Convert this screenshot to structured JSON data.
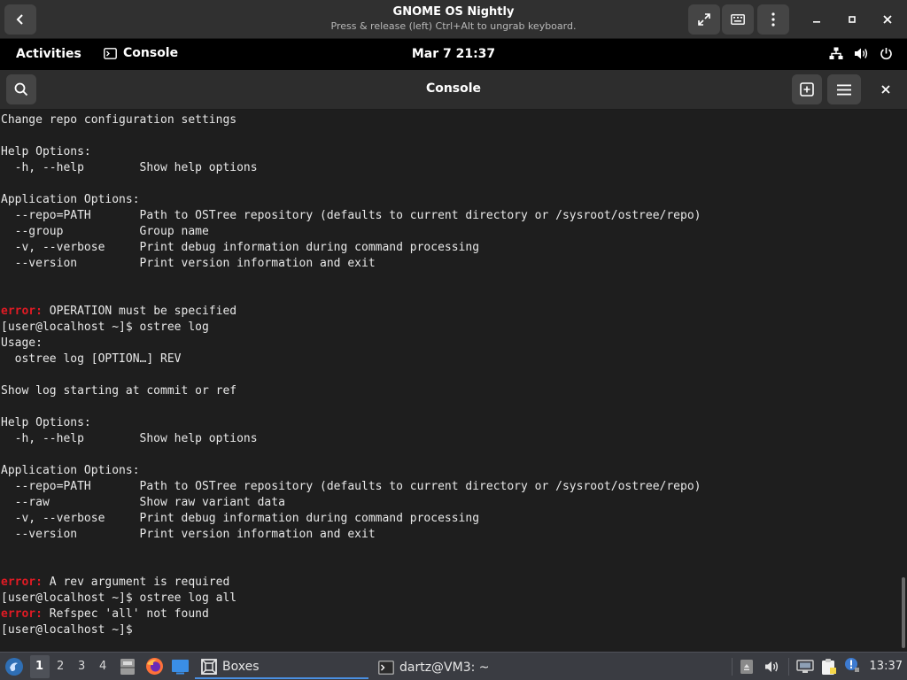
{
  "boxes_window": {
    "title": "GNOME OS Nightly",
    "subtitle": "Press & release (left) Ctrl+Alt to ungrab keyboard."
  },
  "top_bar": {
    "activities": "Activities",
    "app_menu": "Console",
    "clock": "Mar 7  21:37"
  },
  "console": {
    "title": "Console"
  },
  "terminal": {
    "lines": [
      "Change repo configuration settings",
      "",
      "Help Options:",
      "  -h, --help        Show help options",
      "",
      "Application Options:",
      "  --repo=PATH       Path to OSTree repository (defaults to current directory or /sysroot/ostree/repo)",
      "  --group           Group name",
      "  -v, --verbose     Print debug information during command processing",
      "  --version         Print version information and exit",
      "",
      "",
      "error: OPERATION must be specified",
      "[user@localhost ~]$ ostree log",
      "Usage:",
      "  ostree log [OPTION…] REV",
      "",
      "Show log starting at commit or ref",
      "",
      "Help Options:",
      "  -h, --help        Show help options",
      "",
      "Application Options:",
      "  --repo=PATH       Path to OSTree repository (defaults to current directory or /sysroot/ostree/repo)",
      "  --raw             Show raw variant data",
      "  -v, --verbose     Print debug information during command processing",
      "  --version         Print version information and exit",
      "",
      "",
      "error: A rev argument is required",
      "[user@localhost ~]$ ostree log all",
      "error: Refspec 'all' not found",
      "[user@localhost ~]$ "
    ],
    "error_prefix": "error:",
    "error_color": "#e01b24"
  },
  "taskbar": {
    "workspaces": [
      "1",
      "2",
      "3",
      "4"
    ],
    "active_workspace": "1",
    "tasks": [
      {
        "label": "Boxes",
        "icon": "boxes-icon",
        "active": true
      },
      {
        "label": "dartz@VM3: ~",
        "icon": "terminal-icon",
        "active": false
      }
    ],
    "clock": "13:37",
    "accent": "#4a8fe0"
  }
}
